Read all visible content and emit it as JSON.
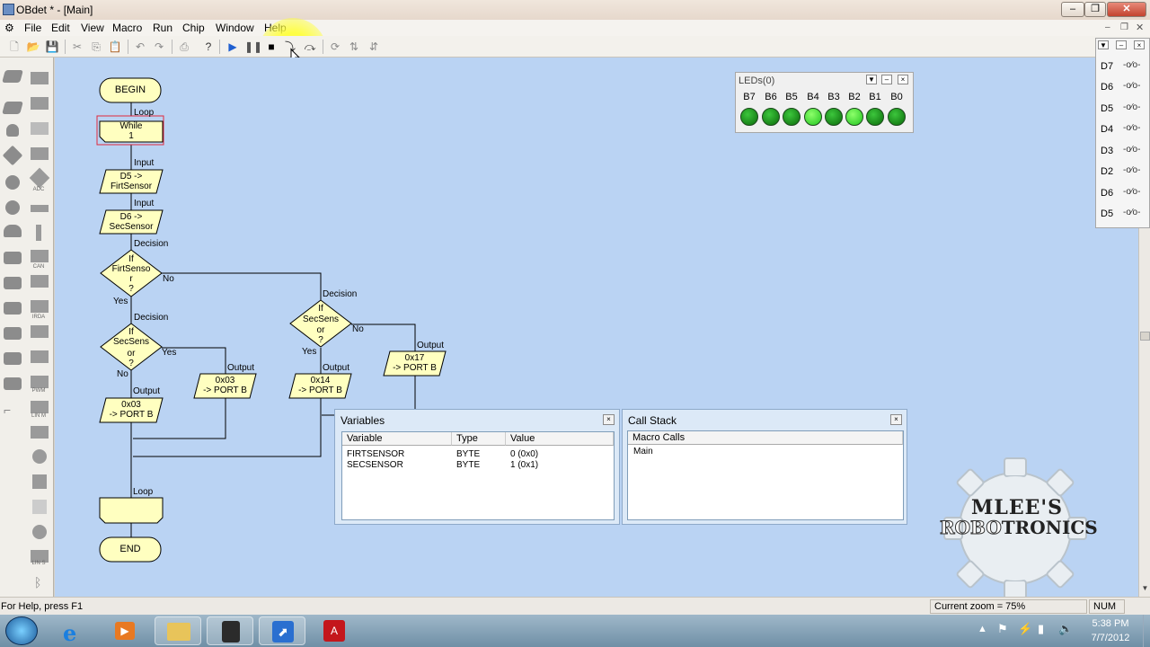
{
  "window": {
    "title": "OBdet * - [Main]"
  },
  "menu": [
    "File",
    "Edit",
    "View",
    "Macro",
    "Run",
    "Chip",
    "Window",
    "Help"
  ],
  "flowchart": {
    "begin": "BEGIN",
    "loop_top": "Loop",
    "while_line1": "While",
    "while_line2": "1",
    "input1_cap": "Input",
    "input1_l1": "D5 ->",
    "input1_l2": "FirtSensor",
    "input2_cap": "Input",
    "input2_l1": "D6 ->",
    "input2_l2": "SecSensor",
    "dec1_cap": "Decision",
    "dec1_l1": "If",
    "dec1_l2": "FirtSenso",
    "dec1_l3": "r",
    "dec1_l4": "?",
    "dec1_no": "No",
    "dec1_yes": "Yes",
    "dec2_cap": "Decision",
    "dec2_l1": "If",
    "dec2_l2": "SecSens",
    "dec2_l3": "or",
    "dec2_l4": "?",
    "dec2_yes": "Yes",
    "dec2_no": "No",
    "dec3_cap": "Decision",
    "dec3_l1": "If",
    "dec3_l2": "SecSens",
    "dec3_l3": "or",
    "dec3_l4": "?",
    "dec3_no": "No",
    "dec3_yes": "Yes",
    "out1_cap": "Output",
    "out1_l1": "0x03",
    "out1_l2": "-> PORT B",
    "out2_cap": "Output",
    "out2_l1": "0x03",
    "out2_l2": "-> PORT B",
    "out3_cap": "Output",
    "out3_l1": "0x14",
    "out3_l2": "-> PORT B",
    "out4_cap": "Output",
    "out4_l1": "0x17",
    "out4_l2": "-> PORT B",
    "loop_bottom": "Loop",
    "end": "END"
  },
  "leds": {
    "title": "LEDs(0)",
    "labels": [
      "B7",
      "B6",
      "B5",
      "B4",
      "B3",
      "B2",
      "B1",
      "B0"
    ],
    "states": [
      0,
      0,
      0,
      1,
      0,
      1,
      0,
      0
    ],
    "on_color": "#5cf23c",
    "off_color": "#0e8a0e"
  },
  "switches": {
    "labels": [
      "D7",
      "D6",
      "D5",
      "D4",
      "D3",
      "D2",
      "D6",
      "D5"
    ]
  },
  "variables": {
    "title": "Variables",
    "headers": [
      "Variable",
      "Type",
      "Value"
    ],
    "rows": [
      [
        "FIRTSENSOR",
        "BYTE",
        "0 (0x0)"
      ],
      [
        "SECSENSOR",
        "BYTE",
        "1 (0x1)"
      ]
    ]
  },
  "callstack": {
    "title": "Call Stack",
    "header": "Macro Calls",
    "rows": [
      "Main"
    ]
  },
  "status": {
    "help": "For Help, press F1",
    "zoom": "Current zoom = 75%",
    "num": "NUM"
  },
  "clock": {
    "time": "5:38 PM",
    "date": "7/7/2012"
  },
  "watermark": {
    "line1": "MLEE'S",
    "line2a": "ROBO",
    "line2b": "TRONICS"
  },
  "colors": {
    "canvas": "#bad3f3",
    "flow_shape": "#ffffc0",
    "accent_highlight": "#ffff3c"
  }
}
